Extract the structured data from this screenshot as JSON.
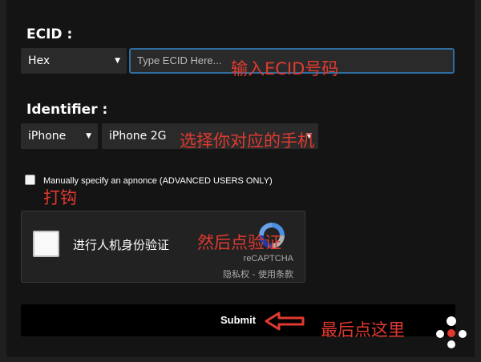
{
  "ecid": {
    "label": "ECID :",
    "format_selected": "Hex",
    "input_placeholder": "Type ECID Here...",
    "annotation": "输入ECID号码"
  },
  "identifier": {
    "label": "Identifier :",
    "device_type_selected": "iPhone",
    "model_selected": "iPhone 2G",
    "annotation": "选择你对应的手机"
  },
  "apnonce": {
    "checked": false,
    "label": "Manually specify an apnonce (ADVANCED USERS ONLY)",
    "annotation": "打钩"
  },
  "captcha": {
    "checkbox_label": "进行人机身份验证",
    "brand": "reCAPTCHA",
    "links": "隐私权 - 使用条款",
    "annotation": "然后点验证"
  },
  "submit": {
    "label": "Submit",
    "annotation": "最后点这里"
  },
  "colors": {
    "annotation_red": "#e03a30",
    "input_border": "#2f6da1",
    "recaptcha_blue": "#4a90e2"
  },
  "icons": {
    "select_arrow": "triangle-down",
    "recaptcha": "recaptcha-logo",
    "pointer": "left-arrow",
    "watermark": "logo-watermark"
  }
}
